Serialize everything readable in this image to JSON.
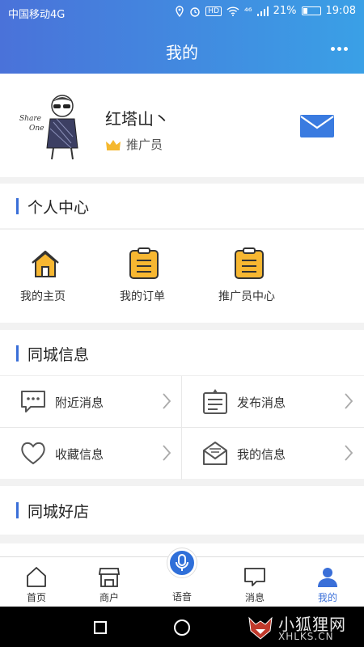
{
  "status_bar": {
    "carrier": "中国移动4G",
    "hd": "HD",
    "signal": "⁴⁶",
    "battery": "21%",
    "time": "19:08"
  },
  "header": {
    "title": "我的"
  },
  "profile": {
    "avatar_text_1": "Share",
    "avatar_text_2": "One",
    "name": "红塔山丶",
    "role": "推广员"
  },
  "personal_center": {
    "title": "个人中心",
    "items": [
      {
        "label": "我的主页",
        "icon": "home-icon"
      },
      {
        "label": "我的订单",
        "icon": "clipboard-icon"
      },
      {
        "label": "推广员中心",
        "icon": "clipboard-icon"
      }
    ]
  },
  "local_info": {
    "title": "同城信息",
    "items": [
      {
        "label": "附近消息",
        "icon": "chat-dots-icon"
      },
      {
        "label": "发布消息",
        "icon": "publish-icon"
      },
      {
        "label": "收藏信息",
        "icon": "heart-icon"
      },
      {
        "label": "我的信息",
        "icon": "envelope-icon"
      }
    ]
  },
  "local_shops": {
    "title": "同城好店"
  },
  "tabbar": {
    "items": [
      {
        "label": "首页",
        "icon": "home-outline-icon"
      },
      {
        "label": "商户",
        "icon": "shop-icon"
      },
      {
        "label": "语音",
        "icon": "microphone-icon"
      },
      {
        "label": "消息",
        "icon": "message-icon"
      },
      {
        "label": "我的",
        "icon": "user-icon"
      }
    ],
    "active": "我的"
  },
  "watermark": {
    "cn": "小狐狸网",
    "en": "XHLKS.CN"
  },
  "colors": {
    "accent": "#3a6fd8",
    "icon_yellow": "#f7b731",
    "header_start": "#4a72d9",
    "header_end": "#3aa0e6"
  }
}
